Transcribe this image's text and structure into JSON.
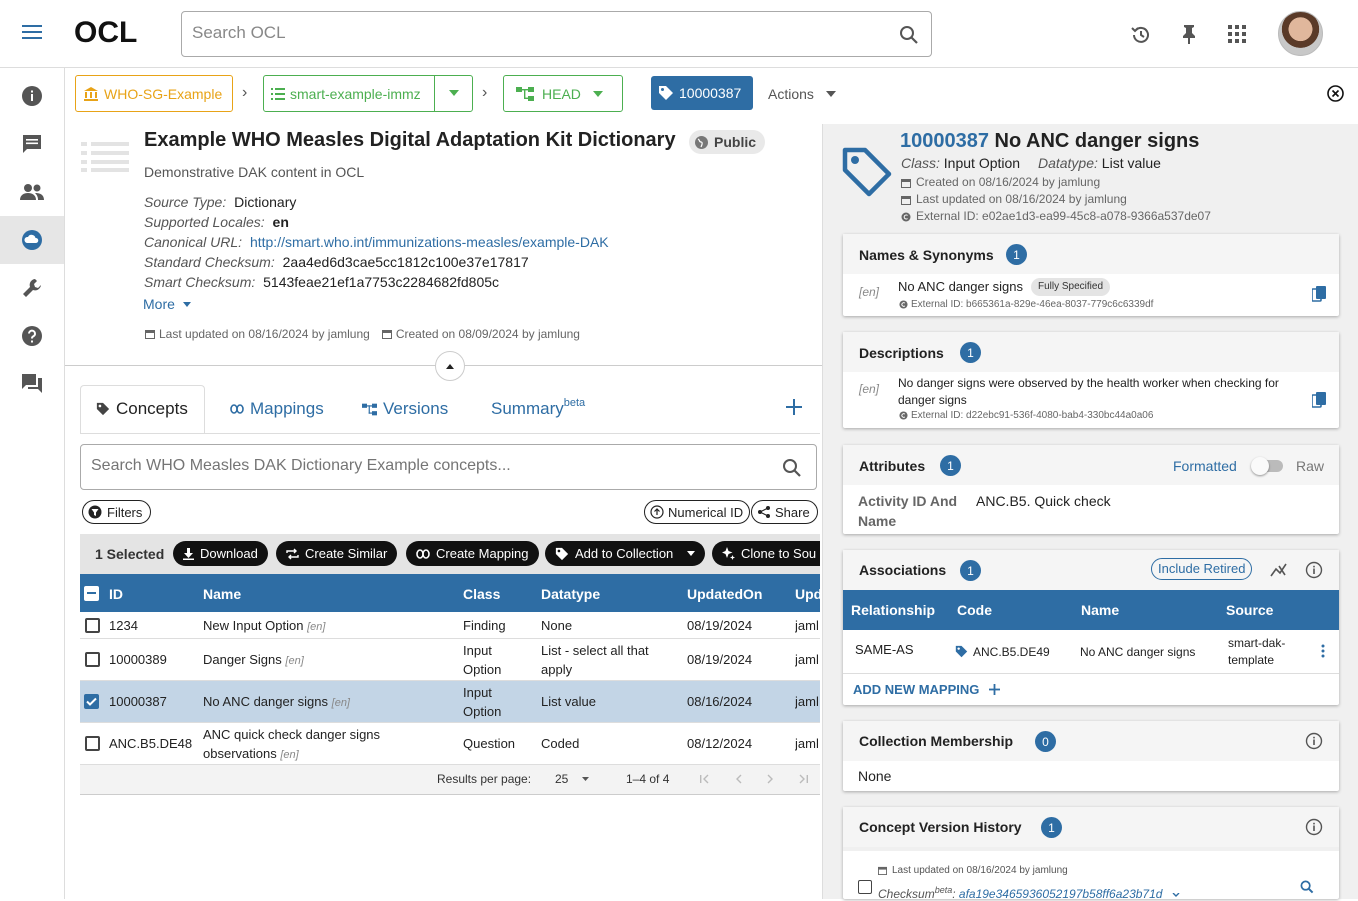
{
  "app": {
    "logo": "OCL",
    "search_placeholder": "Search OCL"
  },
  "breadcrumb": {
    "org": "WHO-SG-Example",
    "source": "smart-example-immz",
    "version": "HEAD",
    "concept_id": "10000387",
    "actions": "Actions"
  },
  "source": {
    "title": "Example WHO Measles Digital Adaptation Kit Dictionary",
    "visibility": "Public",
    "description": "Demonstrative DAK content in OCL",
    "fields": [
      {
        "label": "Source Type:",
        "value": "Dictionary"
      },
      {
        "label": "Supported Locales:",
        "value": "en"
      },
      {
        "label": "Canonical URL:",
        "value": "http://smart.who.int/immunizations-measles/example-DAK"
      },
      {
        "label": "Standard Checksum:",
        "value": "2aa4ed6d3cae5cc1812c100e37e17817"
      },
      {
        "label": "Smart Checksum:",
        "value": "5143feae21ef1a7753c2284682fd805c"
      }
    ],
    "more": "More",
    "last_updated": "Last updated on 08/16/2024 by jamlung",
    "created": "Created on 08/09/2024 by jamlung"
  },
  "tabs": [
    {
      "label": "Concepts"
    },
    {
      "label": "Mappings"
    },
    {
      "label": "Versions"
    },
    {
      "label": "Summary",
      "sup": "beta"
    }
  ],
  "concept_search_placeholder": "Search WHO Measles DAK Dictionary Example concepts...",
  "toolbar": {
    "filters": "Filters",
    "numerical_id": "Numerical ID",
    "share": "Share"
  },
  "selection": {
    "selected": "1 Selected",
    "download": "Download",
    "create_similar": "Create Similar",
    "create_mapping": "Create Mapping",
    "add_to_collection": "Add to Collection",
    "clone_to_source": "Clone to Sou"
  },
  "table": {
    "headers": {
      "id": "ID",
      "name": "Name",
      "class": "Class",
      "datatype": "Datatype",
      "updated": "UpdatedOn",
      "upd": "Upd"
    },
    "rows": [
      {
        "id": "1234",
        "name": "New Input Option",
        "locale": "[en]",
        "class": "Finding",
        "datatype": "None",
        "updated": "08/19/2024",
        "by": "jaml"
      },
      {
        "id": "10000389",
        "name": "Danger Signs",
        "locale": "[en]",
        "class": "Input Option",
        "datatype": "List - select all that apply",
        "updated": "08/19/2024",
        "by": "jaml"
      },
      {
        "id": "10000387",
        "name": "No ANC danger signs",
        "locale": "[en]",
        "class": "Input Option",
        "datatype": "List value",
        "updated": "08/16/2024",
        "by": "jaml"
      },
      {
        "id": "ANC.B5.DE48",
        "name": "ANC quick check danger signs observations",
        "locale": "[en]",
        "class": "Question",
        "datatype": "Coded",
        "updated": "08/12/2024",
        "by": "jaml"
      }
    ],
    "pagination": {
      "label": "Results per page:",
      "per_page": "25",
      "range": "1–4 of 4"
    }
  },
  "concept": {
    "id": "10000387",
    "name": "No ANC danger signs",
    "class_label": "Class:",
    "class": "Input Option",
    "datatype_label": "Datatype:",
    "datatype": "List value",
    "created": "Created on 08/16/2024 by jamlung",
    "updated": "Last updated on 08/16/2024 by jamlung",
    "external_id": "External ID: e02ae1d3-ea99-45c8-a078-9366a537de07"
  },
  "names_card": {
    "title": "Names & Synonyms",
    "count": "1",
    "locale": "[en]",
    "name": "No ANC danger signs",
    "tag": "Fully Specified",
    "external_id": "External ID: b665361a-829e-46ea-8037-779c6c6339df"
  },
  "desc_card": {
    "title": "Descriptions",
    "count": "1",
    "locale": "[en]",
    "text": "No danger signs were observed by the health worker when checking for danger signs",
    "external_id": "External ID: d22ebc91-536f-4080-bab4-330bc44a0a06"
  },
  "attr_card": {
    "title": "Attributes",
    "count": "1",
    "formatted": "Formatted",
    "raw": "Raw",
    "key": "Activity ID And Name",
    "value": "ANC.B5. Quick check"
  },
  "assoc_card": {
    "title": "Associations",
    "count": "1",
    "include_retired": "Include Retired",
    "headers": {
      "rel": "Relationship",
      "code": "Code",
      "name": "Name",
      "source": "Source"
    },
    "row": {
      "rel": "SAME-AS",
      "code": "ANC.B5.DE49",
      "name": "No ANC danger signs",
      "source": "smart-dak-template"
    },
    "add": "ADD NEW MAPPING"
  },
  "coll_card": {
    "title": "Collection Membership",
    "count": "0",
    "none": "None"
  },
  "history_card": {
    "title": "Concept Version History",
    "count": "1",
    "updated": "Last updated on 08/16/2024 by jamlung",
    "checksum_label": "Checksum",
    "checksum_sup": "beta",
    "checksum": "afa19e3465936052197b58ff6a23b71d"
  },
  "colors": {
    "brand": "#2e6da4",
    "org": "#e8a317",
    "source": "#4caf50"
  }
}
